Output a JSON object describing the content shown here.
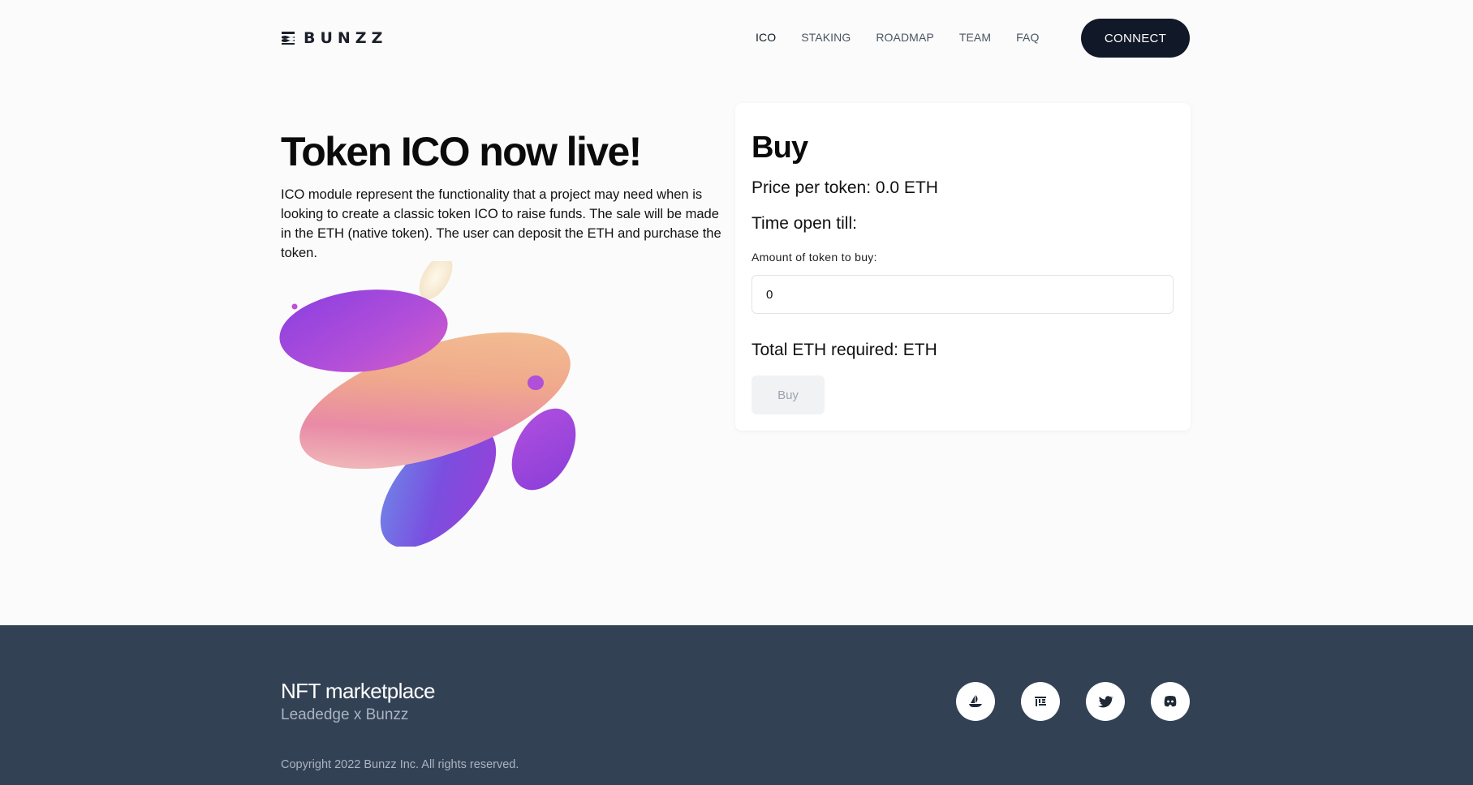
{
  "header": {
    "logo_text": "BUNZZ",
    "nav": [
      {
        "label": "ICO",
        "active": true
      },
      {
        "label": "STAKING",
        "active": false
      },
      {
        "label": "ROADMAP",
        "active": false
      },
      {
        "label": "TEAM",
        "active": false
      },
      {
        "label": "FAQ",
        "active": false
      }
    ],
    "connect_label": "CONNECT"
  },
  "hero": {
    "title": "Token ICO now live!",
    "description": "ICO module represent the functionality that a project may need when is looking to create a classic token ICO to raise funds. The sale will be made in the ETH (native token). The user can deposit the ETH and purchase the token."
  },
  "buy_card": {
    "title": "Buy",
    "price_text": "Price per token: 0.0 ETH",
    "time_text": "Time open till:",
    "amount_label": "Amount of token to buy:",
    "amount_value": "0",
    "total_text": "Total ETH required: ETH",
    "buy_label": "Buy"
  },
  "footer": {
    "title": "NFT marketplace",
    "subtitle": "Leadedge x Bunzz",
    "copyright": "Copyright 2022 Bunzz Inc. All rights reserved.",
    "socials": [
      {
        "icon": "opensea-icon"
      },
      {
        "icon": "looksrare-icon"
      },
      {
        "icon": "twitter-icon"
      },
      {
        "icon": "discord-icon"
      }
    ]
  },
  "colors": {
    "accent_dark": "#111827",
    "footer_bg": "#334155",
    "page_bg": "#fbfbfb"
  }
}
